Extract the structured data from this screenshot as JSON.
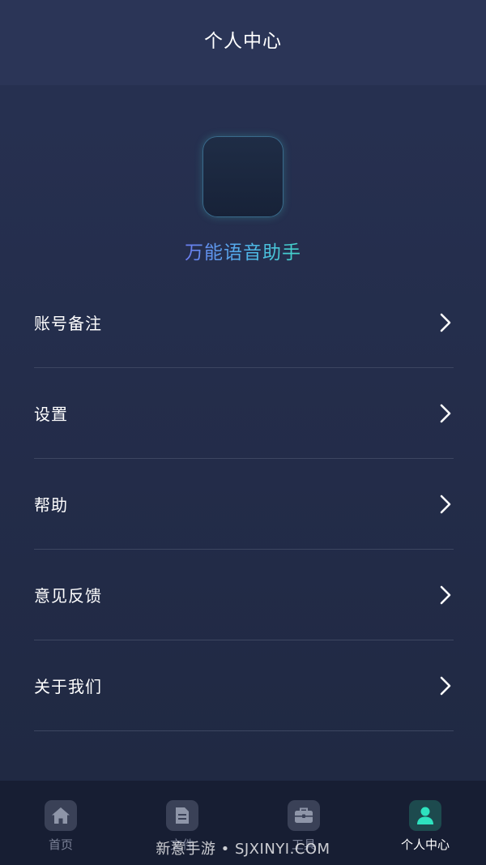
{
  "header": {
    "title": "个人中心"
  },
  "app": {
    "name": "万能语音助手",
    "logo_icon": "sound-wave-icon"
  },
  "menu": {
    "items": [
      {
        "label": "账号备注",
        "icon": "chevron-right-icon"
      },
      {
        "label": "设置",
        "icon": "chevron-right-icon"
      },
      {
        "label": "帮助",
        "icon": "chevron-right-icon"
      },
      {
        "label": "意见反馈",
        "icon": "chevron-right-icon"
      },
      {
        "label": "关于我们",
        "icon": "chevron-right-icon"
      }
    ]
  },
  "tabbar": {
    "tabs": [
      {
        "label": "首页",
        "icon": "home-icon",
        "active": false
      },
      {
        "label": "文件",
        "icon": "file-icon",
        "active": false
      },
      {
        "label": "工具",
        "icon": "briefcase-icon",
        "active": false
      },
      {
        "label": "个人中心",
        "icon": "user-icon",
        "active": true
      }
    ]
  },
  "watermark": {
    "text": "新意手游 • SJXINYI.COM"
  },
  "colors": {
    "background": "#232c49",
    "header": "#2b3557",
    "tabbar": "#171e33",
    "accent": "#43d5c8",
    "divider": "#3d4661"
  }
}
